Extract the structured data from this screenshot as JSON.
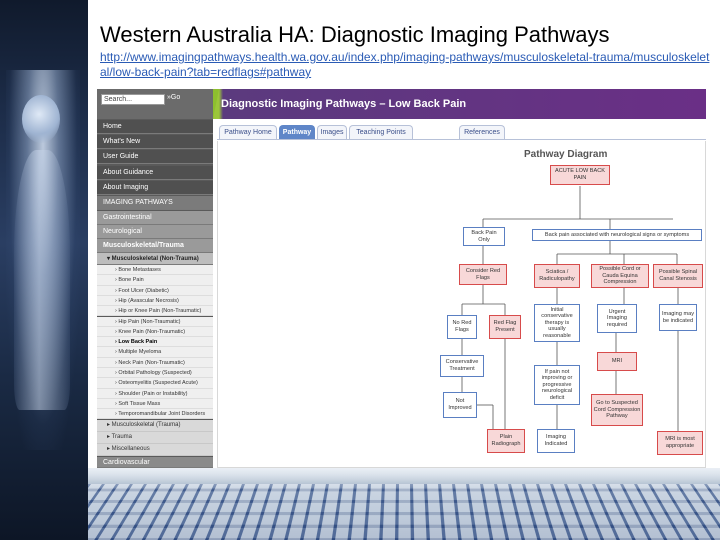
{
  "slide": {
    "title": "Western Australia HA: Diagnostic Imaging Pathways",
    "link_line1": "http://www.imagingpathways.health.wa.gov.au/index.php/imaging-pathways/musculoskeletal-",
    "link_line2": "trauma/musculoskeletal/low-back-pain?tab=redflags#pathway"
  },
  "site": {
    "search_placeholder": "Search...",
    "go_label": "»Go",
    "banner_title": "Diagnostic Imaging Pathways – Low Back Pain",
    "nav": {
      "home": "Home",
      "whats_new": "What's New",
      "user_guide": "User Guide",
      "about_guidance": "About Guidance",
      "about_imaging": "About Imaging",
      "imaging_pathways": "IMAGING PATHWAYS",
      "gastrointestinal": "Gastrointestinal",
      "neurological": "Neurological",
      "msk_trauma": "Musculoskeletal/Trauma",
      "msk_non_trauma": "▾ Musculoskeletal (Non-Trauma)",
      "leaves": [
        "› Bone Metastases",
        "› Bone Pain",
        "› Foot Ulcer (Diabetic)",
        "› Hip (Avascular Necrosis)",
        "› Hip or Knee Pain (Non-Traumatic)",
        "› Hip Pain (Non-Traumatic)",
        "› Knee Pain (Non-Traumatic)",
        "› Low Back Pain",
        "› Multiple Myeloma",
        "› Neck Pain (Non-Traumatic)",
        "› Orbital Pathology (Suspected)",
        "› Osteomyelitis (Suspected Acute)",
        "› Shoulder (Pain or Instability)",
        "› Soft Tissue Mass",
        "› Temporomandibular Joint Disorders"
      ],
      "msk_trauma_sub": "▸ Musculoskeletal (Trauma)",
      "trauma": "▸ Trauma",
      "misc": "▸ Miscellaneous",
      "cardio": "Cardiovascular"
    },
    "tabs": [
      "Pathway Home",
      "Pathway",
      "Images",
      "Teaching Points",
      "References"
    ],
    "diagram": {
      "title": "Pathway Diagram",
      "acute": "ACUTE LOW BACK PAIN",
      "back_only": "Back Pain Only",
      "neuro": "Back pain associated with neurological signs or symptoms",
      "red_flags": "Consider Red Flags",
      "sciatica": "Sciatica / Radiculopathy",
      "cauda": "Possible Cord or Cauda Equina Compression",
      "stenosis": "Possible Spinal Canal Stenosis",
      "no_red": "No Red Flags",
      "red_present": "Red Flag Present",
      "initial": "Initial conservative therapy is usually reasonable",
      "urgent": "Urgent Imaging required",
      "may_be": "Imaging may be indicated",
      "conservative": "Conservative Treatment",
      "mri": "MRI",
      "if_pain": "If pain not improving or progressive neurological deficit",
      "not_improved": "Not Improved",
      "go_suspected": "Go to Suspected Cord Compression Pathway",
      "plain": "Plain Radiograph",
      "img_indicated": "Imaging Indicated",
      "mri_most": "MRI is most appropriate"
    }
  },
  "colors": {
    "banner_purple": "#6a2f86",
    "banner_green": "#9bc63a",
    "link_blue": "#2a5bb5",
    "box_blue": "#5a7fc2",
    "box_red": "#d74b4b",
    "box_red_fill": "#f8d8d8"
  }
}
